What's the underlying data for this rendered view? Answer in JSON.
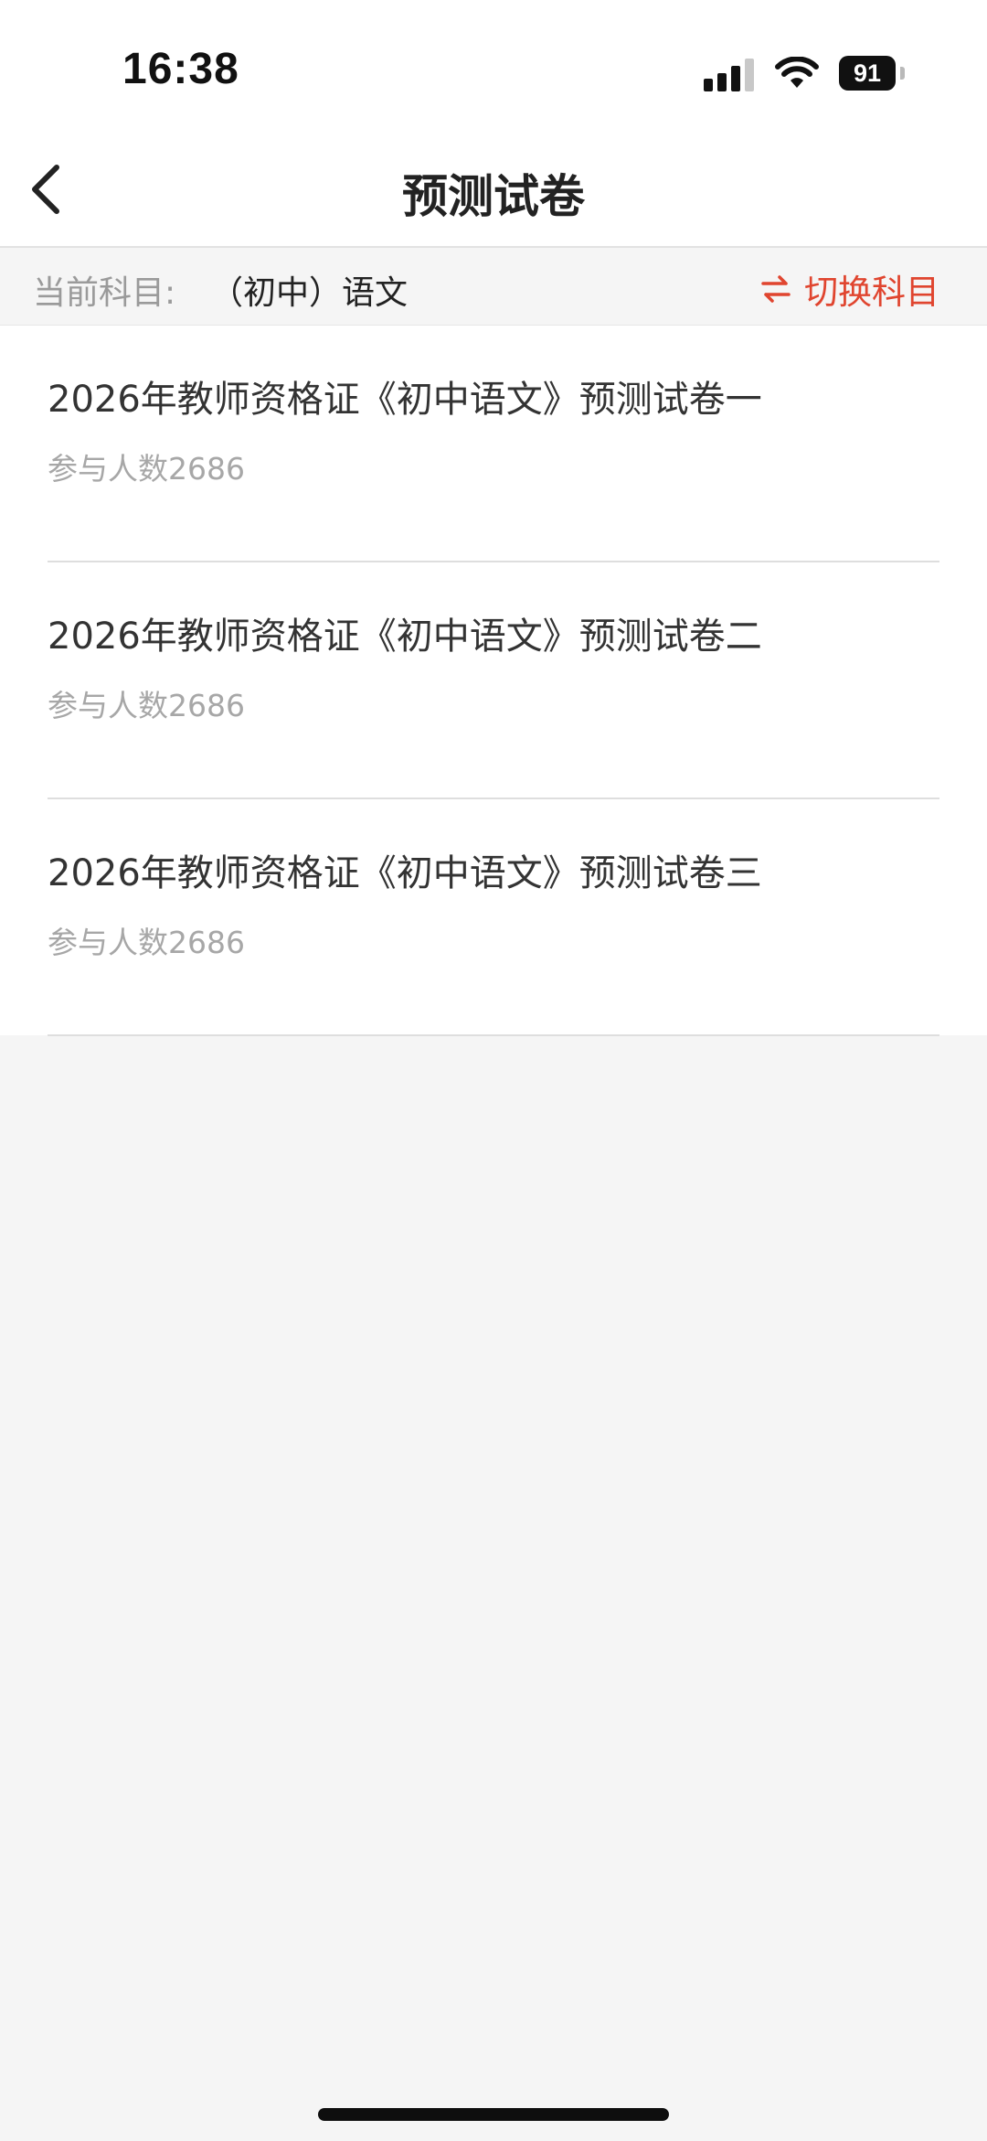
{
  "status_bar": {
    "time": "16:38",
    "battery": "91",
    "icons": [
      "signal-icon",
      "wifi-icon",
      "battery-icon"
    ]
  },
  "nav": {
    "title": "预测试卷",
    "back_icon": "chevron-left-icon"
  },
  "subject": {
    "label": "当前科目:",
    "value": "（初中）语文",
    "switch_label": "切换科目",
    "switch_icon": "swap-arrows-icon",
    "accent_color": "#e0452f"
  },
  "papers": [
    {
      "title": "2026年教师资格证《初中语文》预测试卷一",
      "participants": "参与人数2686"
    },
    {
      "title": "2026年教师资格证《初中语文》预测试卷二",
      "participants": "参与人数2686"
    },
    {
      "title": "2026年教师资格证《初中语文》预测试卷三",
      "participants": "参与人数2686"
    }
  ]
}
